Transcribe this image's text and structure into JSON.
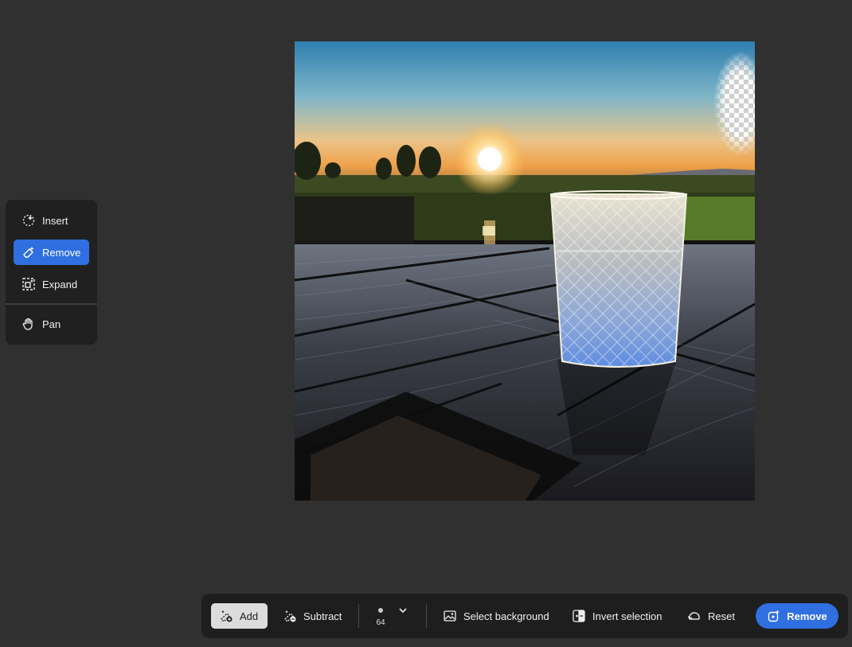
{
  "tools": {
    "items": [
      {
        "id": "insert",
        "label": "Insert",
        "icon": "insert-sparkle-icon",
        "active": false
      },
      {
        "id": "remove",
        "label": "Remove",
        "icon": "eraser-icon",
        "active": true
      },
      {
        "id": "expand",
        "label": "Expand",
        "icon": "expand-icon",
        "active": false
      },
      {
        "id": "pan",
        "label": "Pan",
        "icon": "hand-icon",
        "active": false
      }
    ]
  },
  "toolbar": {
    "add_label": "Add",
    "subtract_label": "Subtract",
    "brush_size": "64",
    "select_background_label": "Select background",
    "invert_selection_label": "Invert selection",
    "reset_label": "Reset",
    "remove_label": "Remove"
  },
  "colors": {
    "accent": "#2f6fe0",
    "panel": "#202020",
    "background": "#303030"
  }
}
